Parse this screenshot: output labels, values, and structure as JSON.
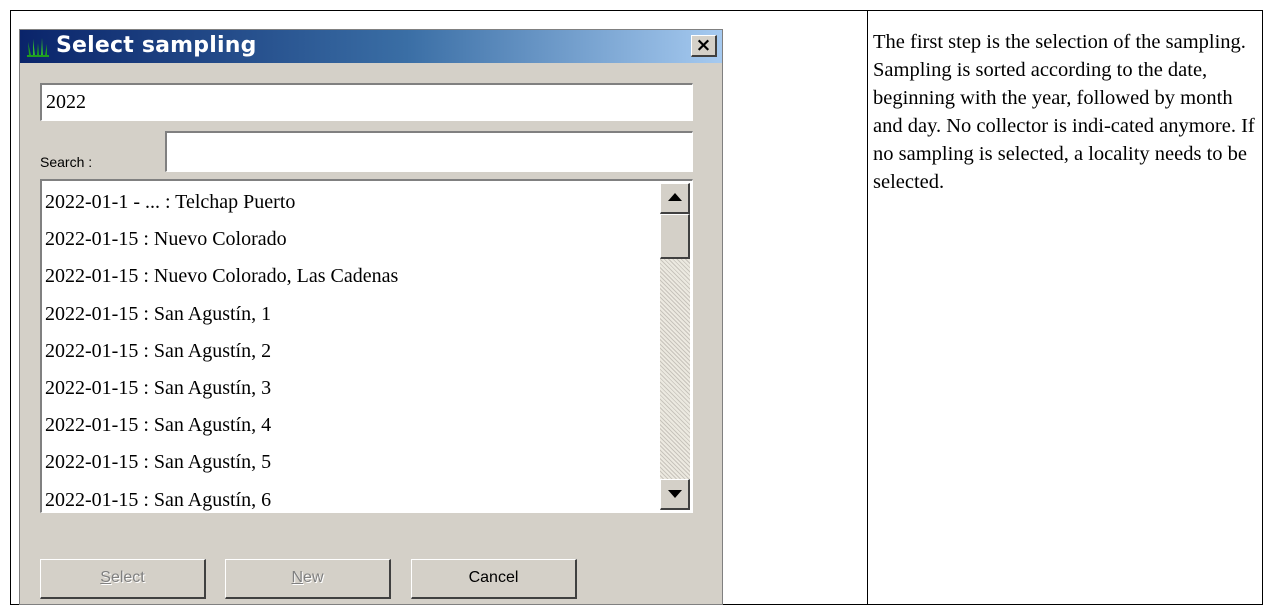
{
  "dialog": {
    "title": "Select sampling",
    "close_label": "×",
    "year_value": "2022",
    "search_label": "Search :",
    "search_value": "",
    "list_items": [
      "2022-01-1 - ... : Telchap Puerto",
      "2022-01-15 : Nuevo Colorado",
      "2022-01-15 : Nuevo Colorado, Las Cadenas",
      "2022-01-15 : San Agustín, 1",
      "2022-01-15 : San Agustín, 2",
      "2022-01-15 : San Agustín, 3",
      "2022-01-15 : San Agustín, 4",
      "2022-01-15 : San Agustín, 5",
      "2022-01-15 : San Agustín, 6"
    ],
    "buttons": {
      "select_mnemonic": "S",
      "select_rest": "elect",
      "new_mnemonic": "N",
      "new_rest": "ew",
      "cancel": "Cancel"
    }
  },
  "description": "The first step is the selection of the sampling. Sampling is sorted according to the date, beginning with the year, followed by month and day. No collector is indi-cated anymore. If no sampling is selected, a locality needs to be selected.",
  "colors": {
    "title_gradient_start": "#0a246a",
    "title_gradient_end": "#a6caf0",
    "dialog_face": "#d4d0c8",
    "icon_green": "#1e9e1e"
  }
}
